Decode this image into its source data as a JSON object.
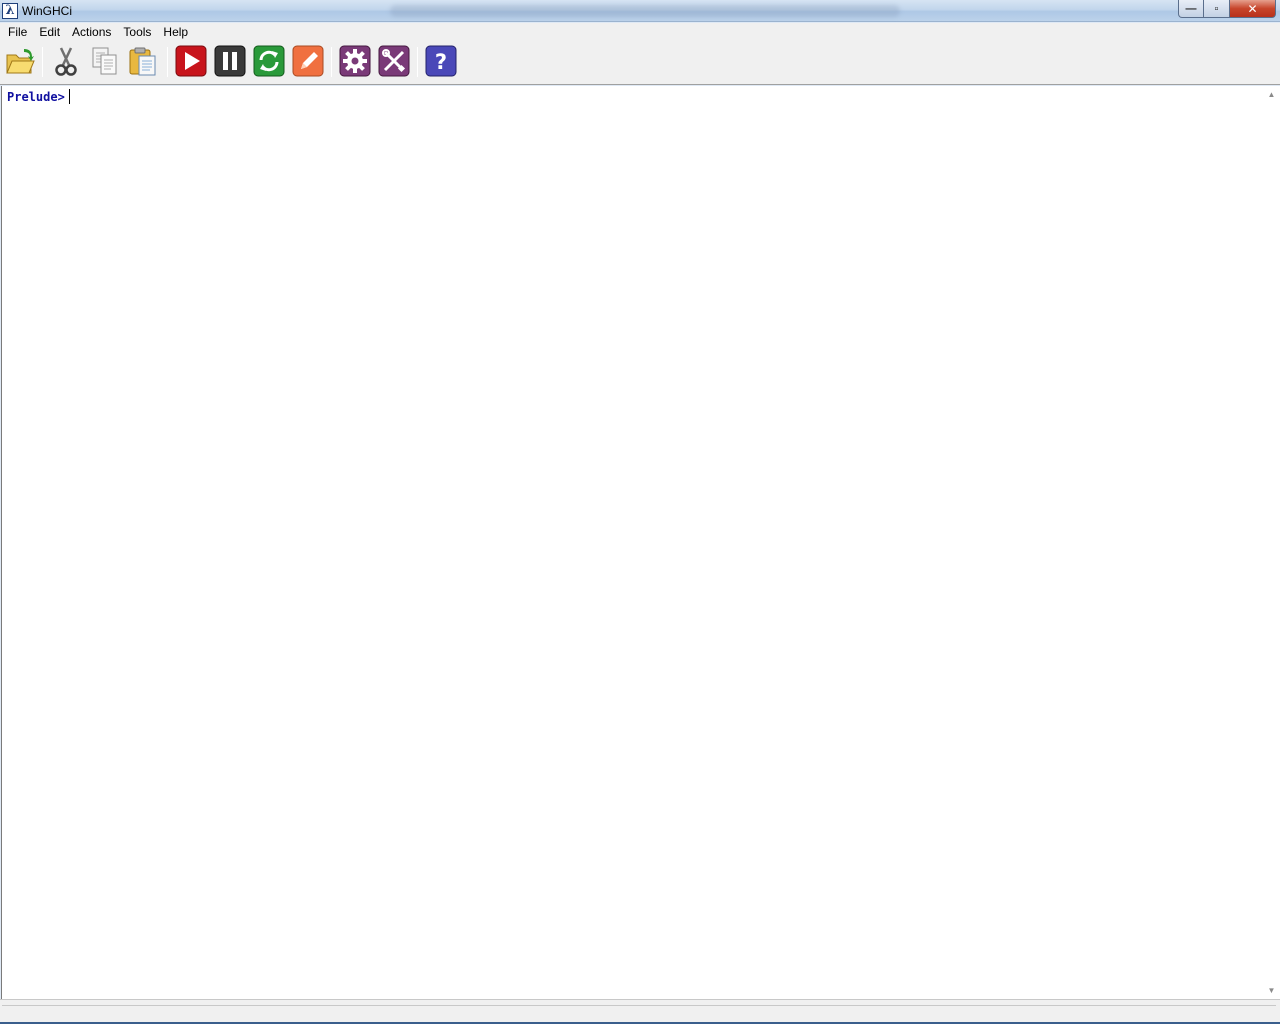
{
  "window": {
    "title": "WinGHCi",
    "app_icon_glyph": "λ",
    "controls": {
      "minimize": "—",
      "maximize": "▫",
      "close": "✕"
    }
  },
  "menu": {
    "items": [
      "File",
      "Edit",
      "Actions",
      "Tools",
      "Help"
    ]
  },
  "toolbar": {
    "buttons": [
      {
        "name": "open-icon",
        "label": "Open"
      },
      {
        "name": "cut-icon",
        "label": "Cut"
      },
      {
        "name": "copy-icon",
        "label": "Copy"
      },
      {
        "name": "paste-icon",
        "label": "Paste"
      },
      {
        "name": "run-icon",
        "label": "Run"
      },
      {
        "name": "pause-icon",
        "label": "Pause"
      },
      {
        "name": "reload-icon",
        "label": "Reload"
      },
      {
        "name": "edit-icon",
        "label": "Edit"
      },
      {
        "name": "options-icon",
        "label": "Options"
      },
      {
        "name": "tools-icon",
        "label": "Tools"
      },
      {
        "name": "help-icon",
        "label": "Help"
      }
    ],
    "colors": {
      "run": "#c8141c",
      "pause": "#3a3a3a",
      "reload": "#2a9a3a",
      "edit": "#f07040",
      "options": "#7a3a78",
      "tools": "#7a3a78",
      "help": "#4a48b8"
    }
  },
  "console": {
    "prompt": "Prelude>",
    "input_value": "",
    "prompt_color": "#1010a0"
  },
  "scrollbar": {
    "up": "▲",
    "down": "▼"
  }
}
